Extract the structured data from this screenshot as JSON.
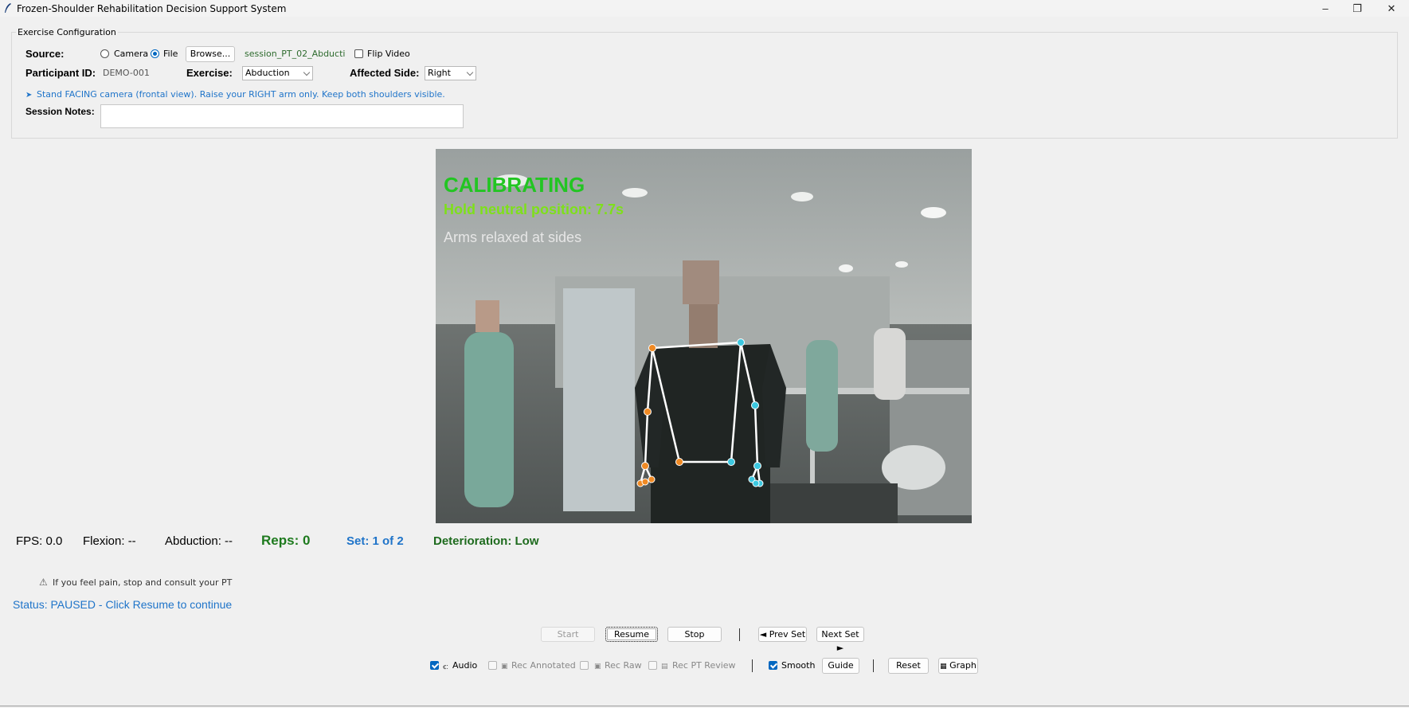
{
  "window": {
    "title": "Frozen-Shoulder Rehabilitation Decision Support System",
    "minimize": "–",
    "maximize": "❐",
    "close": "✕"
  },
  "config": {
    "legend": "Exercise Configuration",
    "source_label": "Source:",
    "source_options": [
      "Camera",
      "File"
    ],
    "source_selected": "File",
    "browse_label": "Browse...",
    "file_name": "session_PT_02_Abducti",
    "flip_video_label": "Flip Video",
    "flip_video_checked": false,
    "participant_label": "Participant ID:",
    "participant_value": "DEMO-001",
    "exercise_label": "Exercise:",
    "exercise_value": "Abduction",
    "side_label": "Affected Side:",
    "side_value": "Right",
    "instruction": "Stand FACING camera (frontal view). Raise your RIGHT arm only. Keep both shoulders visible.",
    "notes_label": "Session Notes:",
    "notes_value": ""
  },
  "video": {
    "overlay_title": "CALIBRATING",
    "overlay_hold": "Hold neutral position: 7.7s",
    "overlay_hint": "Arms relaxed at sides"
  },
  "stats": {
    "fps": "FPS: 0.0",
    "flexion": "Flexion: --",
    "abduction": "Abduction: --",
    "reps": "Reps: 0",
    "set": "Set: 1 of 2",
    "deterioration": "Deterioration: Low"
  },
  "warning": "If you feel pain, stop and consult your PT",
  "status": "Status: PAUSED - Click Resume to continue",
  "controls": {
    "start": "Start",
    "resume": "Resume",
    "stop": "Stop",
    "prev_set": "◄ Prev Set",
    "next_set": "Next Set ►"
  },
  "options": {
    "audio": "Audio",
    "audio_checked": true,
    "rec_annotated": "Rec Annotated",
    "rec_raw": "Rec Raw",
    "rec_pt_review": "Rec PT Review",
    "smooth": "Smooth",
    "smooth_checked": true,
    "guide": "Guide",
    "reset": "Reset",
    "graph": "Graph"
  },
  "colors": {
    "accent_blue": "#0067c0",
    "calibrating_green": "#22c522",
    "hold_green": "#7ee01a",
    "reps_green": "#1e7a1e",
    "set_blue": "#1f74c9",
    "left_joint_orange": "#f08a24",
    "right_joint_cyan": "#3cc8e0"
  }
}
